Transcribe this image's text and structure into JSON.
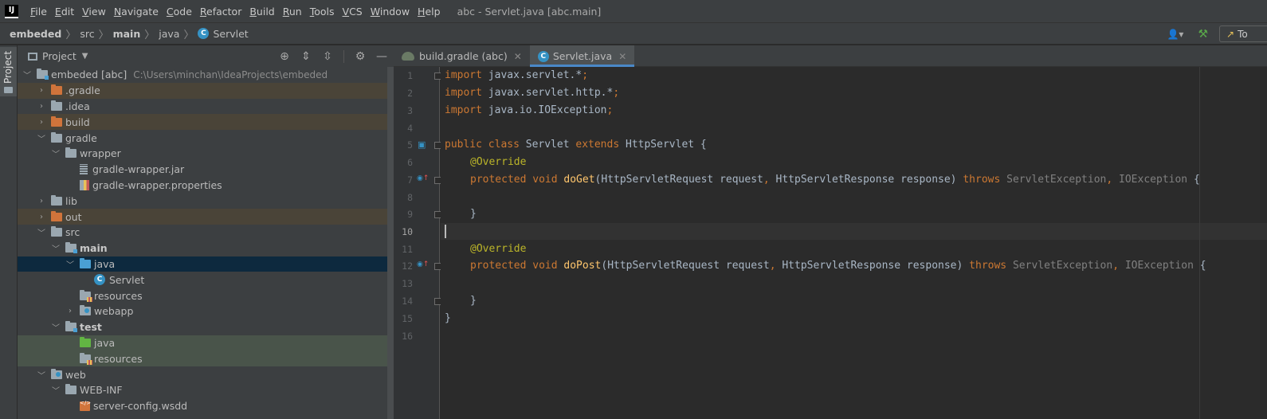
{
  "menubar": {
    "logo": "IJ",
    "items": [
      {
        "label": "File"
      },
      {
        "label": "Edit"
      },
      {
        "label": "View"
      },
      {
        "label": "Navigate"
      },
      {
        "label": "Code"
      },
      {
        "label": "Refactor"
      },
      {
        "label": "Build"
      },
      {
        "label": "Run"
      },
      {
        "label": "Tools"
      },
      {
        "label": "VCS"
      },
      {
        "label": "Window"
      },
      {
        "label": "Help"
      }
    ],
    "window_title": "abc - Servlet.java [abc.main]"
  },
  "breadcrumb": {
    "items": [
      "embeded",
      "src",
      "main",
      "java",
      "Servlet"
    ],
    "class_icon": "C"
  },
  "toolbar": {
    "run_config_label": "To",
    "user_icon": "user-icon",
    "build_icon": "hammer-icon"
  },
  "project_panel": {
    "strip_label": "Project",
    "title": "Project",
    "tree": [
      {
        "label": "embeded [abc]",
        "path": "C:\\Users\\minchan\\IdeaProjects\\embeded"
      },
      {
        "label": ".gradle"
      },
      {
        "label": ".idea"
      },
      {
        "label": "build"
      },
      {
        "label": "gradle"
      },
      {
        "label": "wrapper"
      },
      {
        "label": "gradle-wrapper.jar"
      },
      {
        "label": "gradle-wrapper.properties"
      },
      {
        "label": "lib"
      },
      {
        "label": "out"
      },
      {
        "label": "src"
      },
      {
        "label": "main"
      },
      {
        "label": "java"
      },
      {
        "label": "Servlet"
      },
      {
        "label": "resources"
      },
      {
        "label": "webapp"
      },
      {
        "label": "test"
      },
      {
        "label": "java"
      },
      {
        "label": "resources"
      },
      {
        "label": "web"
      },
      {
        "label": "WEB-INF"
      },
      {
        "label": "server-config.wsdd"
      }
    ]
  },
  "editor": {
    "tabs": [
      {
        "label": "build.gradle (abc)"
      },
      {
        "label": "Servlet.java"
      }
    ],
    "line_numbers": [
      "1",
      "2",
      "3",
      "4",
      "5",
      "6",
      "7",
      "8",
      "9",
      "10",
      "11",
      "12",
      "13",
      "14",
      "15",
      "16"
    ],
    "code": {
      "l1_kw": "import",
      "l1_rest": " javax.servlet.*",
      "l1_semi": ";",
      "l2_kw": "import",
      "l2_rest": " javax.servlet.http.*",
      "l2_semi": ";",
      "l3_kw": "import",
      "l3_rest": " java.io.IOException",
      "l3_semi": ";",
      "l5_kw1": "public class",
      "l5_name": " Servlet ",
      "l5_kw2": "extends",
      "l5_rest": " HttpServlet {",
      "l6_ann": "@Override",
      "l7_kw": "protected void",
      "l7_fn": "doGet",
      "l7_p1": "(HttpServletRequest request",
      "l7_c1": ",",
      "l7_p2": " HttpServletResponse response) ",
      "l7_throws": "throws",
      "l7_e1": " ServletException",
      "l7_c2": ",",
      "l7_e2": " IOException",
      "l7_end": " {",
      "l9": "}",
      "l11_ann": "@Override",
      "l12_kw": "protected void",
      "l12_fn": "doPost",
      "l12_p1": "(HttpServletRequest request",
      "l12_c1": ",",
      "l12_p2": " HttpServletResponse response) ",
      "l12_throws": "throws",
      "l12_e1": " ServletException",
      "l12_c2": ",",
      "l12_e2": " IOException",
      "l12_end": " {",
      "l14": "}",
      "l15": "}"
    }
  },
  "colors": {
    "keyword": "#cc7832",
    "annotation": "#bbb529",
    "method": "#ffc66d",
    "text": "#a9b7c6"
  }
}
